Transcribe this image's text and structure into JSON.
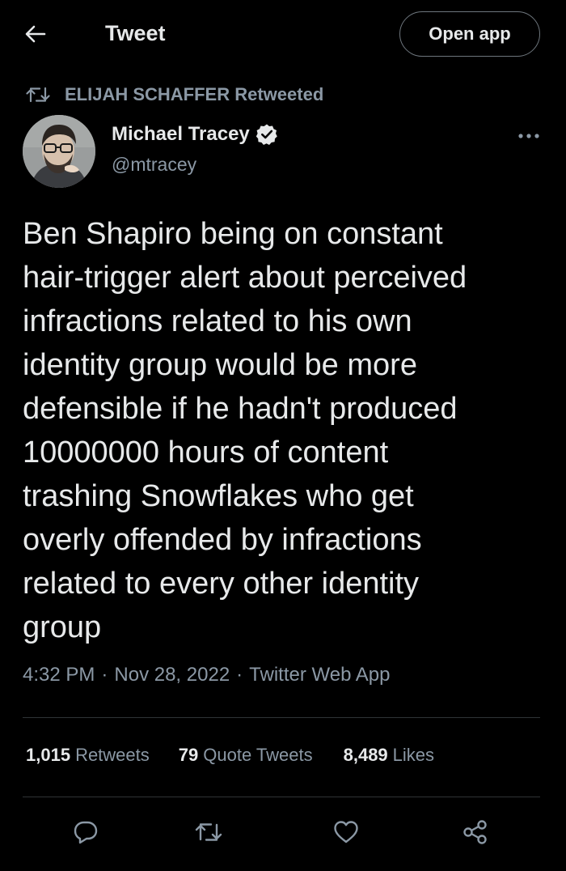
{
  "header": {
    "back_icon": "arrow-left-icon",
    "title": "Tweet",
    "open_app_label": "Open app"
  },
  "retweet_context": {
    "icon": "retweet-icon",
    "text": "ELIJAH SCHAFFER Retweeted"
  },
  "tweet": {
    "author": {
      "name": "Michael Tracey",
      "handle": "@mtracey",
      "verified": true,
      "verified_icon": "verified-badge-icon"
    },
    "text": "Ben Shapiro being on constant\nhair-trigger alert about perceived\ninfractions related to his own\nidentity group would be more\ndefensible if he hadn't produced\n10000000 hours of content\ntrashing Snowflakes who get\noverly offended by infractions\nrelated to every other identity\ngroup",
    "time": "4:32 PM",
    "date": "Nov 28, 2022",
    "source": "Twitter Web App",
    "separator": "·"
  },
  "stats": {
    "retweets": {
      "count": "1,015",
      "label": "Retweets"
    },
    "quotes": {
      "count": "79",
      "label": "Quote Tweets"
    },
    "likes": {
      "count": "8,489",
      "label": "Likes"
    }
  },
  "actions": [
    "reply-icon",
    "retweet-icon",
    "like-heart-icon",
    "share-icon"
  ],
  "colors": {
    "background": "#000000",
    "text_primary": "#e7e9ea",
    "text_secondary": "#8b98a5",
    "divider": "#2f3336"
  }
}
